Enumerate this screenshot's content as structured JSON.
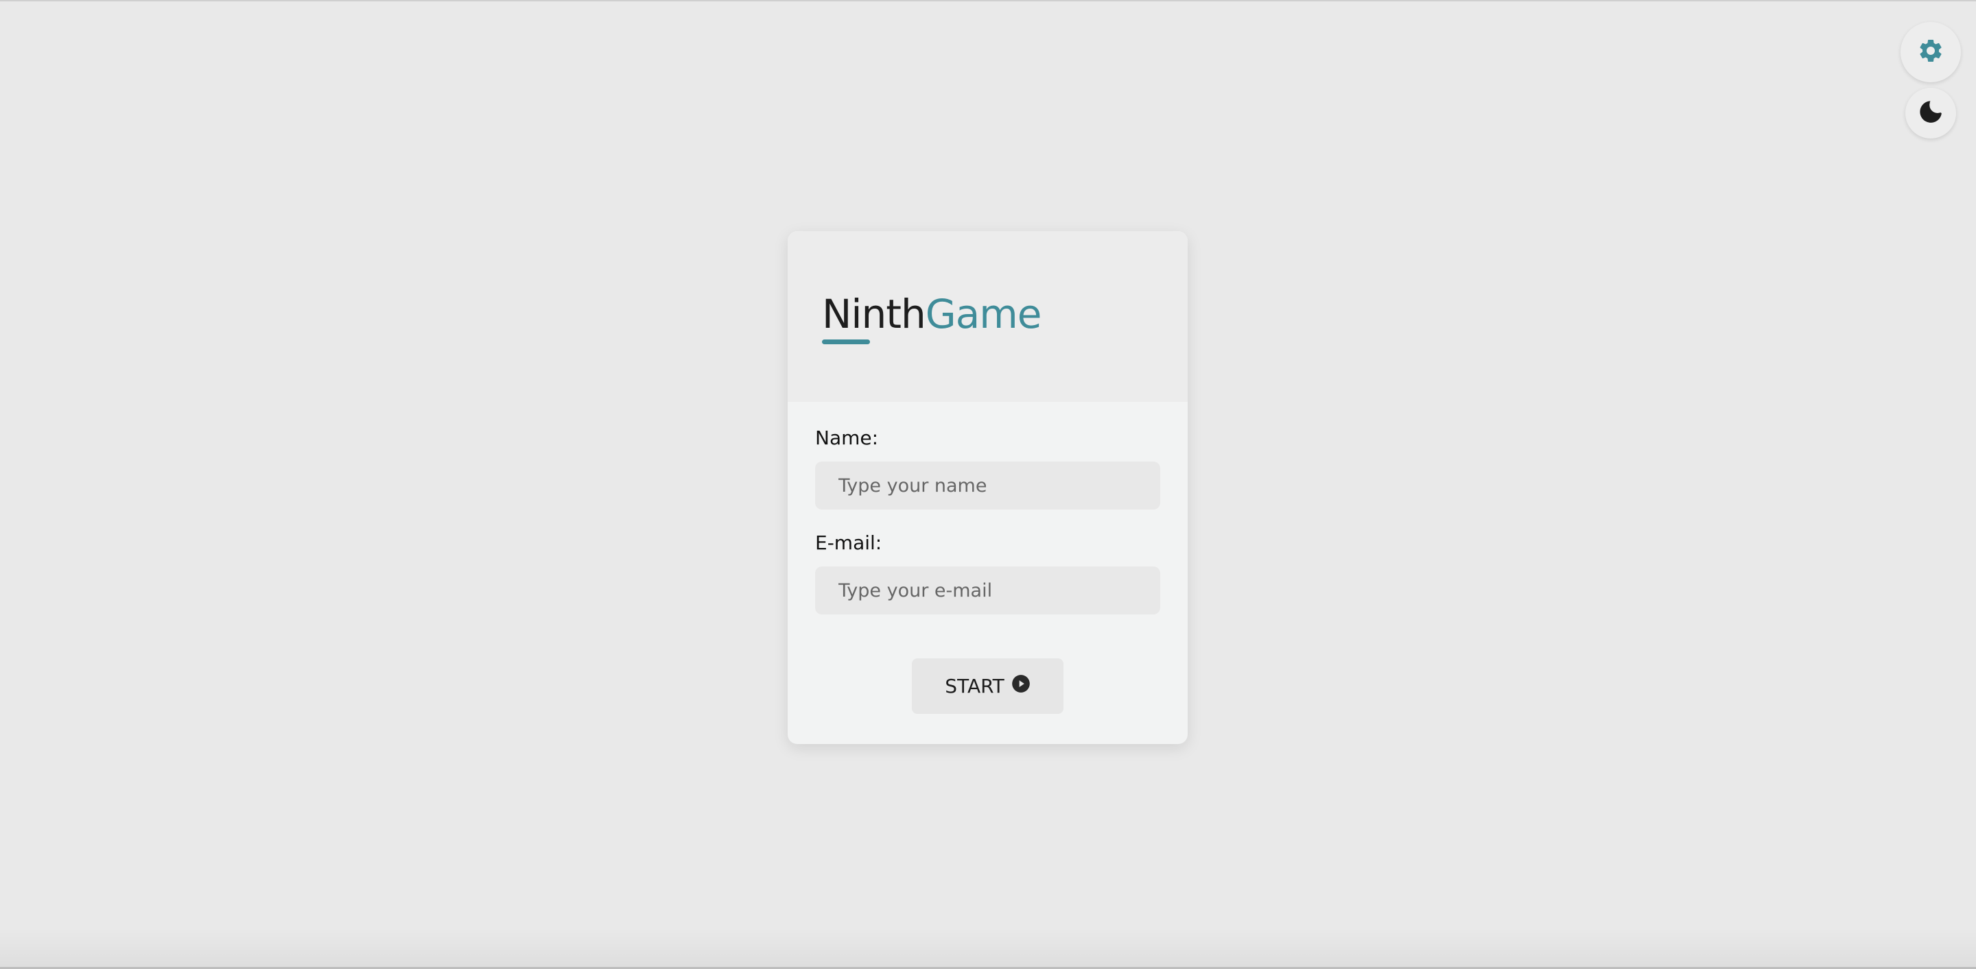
{
  "app": {
    "logo_part1": "Ninth",
    "logo_part2": "Game"
  },
  "top_controls": {
    "settings_icon": "gear-icon",
    "theme_icon": "moon-icon"
  },
  "form": {
    "name_label": "Name:",
    "name_placeholder": "Type your name",
    "name_value": "",
    "email_label": "E-mail:",
    "email_placeholder": "Type your e-mail",
    "email_value": "",
    "start_label": "START",
    "start_icon": "play-circle-icon"
  },
  "colors": {
    "accent": "#3f8c99",
    "background": "#e9e9e9",
    "text": "#1d1d1d"
  }
}
